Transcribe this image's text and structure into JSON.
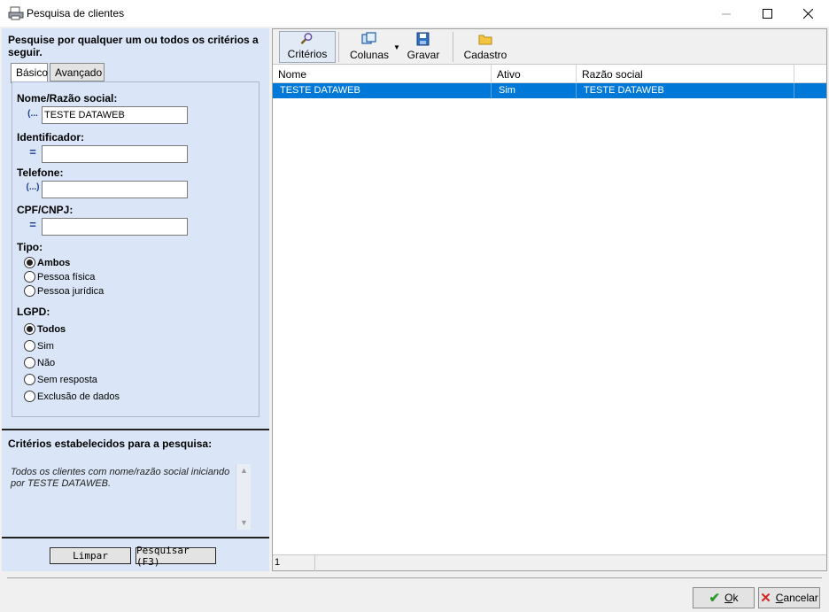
{
  "window": {
    "title": "Pesquisa de clientes",
    "minimize_icon": "minimize-icon",
    "maximize_icon": "maximize-icon",
    "close_icon": "close-icon"
  },
  "left": {
    "prompt": "Pesquise por qualquer um ou todos os critérios a seguir.",
    "tabs": [
      {
        "label": "Básico",
        "active": true
      },
      {
        "label": "Avançado",
        "active": false
      }
    ],
    "fields": [
      {
        "label": "Nome/Razão social:",
        "operator": "(...",
        "value": "TESTE DATAWEB"
      },
      {
        "label": "Identificador:",
        "operator": "=",
        "value": ""
      },
      {
        "label": "Telefone:",
        "operator": "(...)",
        "value": ""
      },
      {
        "label": "CPF/CNPJ:",
        "operator": "=",
        "value": ""
      }
    ],
    "tipo": {
      "label": "Tipo:",
      "options": [
        {
          "label": "Ambos",
          "selected": true
        },
        {
          "label": "Pessoa física",
          "selected": false
        },
        {
          "label": "Pessoa jurídica",
          "selected": false
        }
      ]
    },
    "lgpd": {
      "label": "LGPD:",
      "options": [
        {
          "label": "Todos",
          "selected": true
        },
        {
          "label": "Sim",
          "selected": false
        },
        {
          "label": "Não",
          "selected": false
        },
        {
          "label": "Sem resposta",
          "selected": false
        },
        {
          "label": "Exclusão de dados",
          "selected": false
        }
      ]
    },
    "criteria_title": "Critérios estabelecidos para a pesquisa:",
    "criteria_text": "Todos os clientes com nome/razão social iniciando por TESTE DATAWEB.",
    "buttons": {
      "clear": "Limpar",
      "search": "Pesquisar (F3)"
    }
  },
  "toolbar": {
    "criterios": "Critérios",
    "colunas": "Colunas",
    "gravar": "Gravar",
    "cadastro": "Cadastro"
  },
  "grid": {
    "columns": [
      "Nome",
      "Ativo",
      "Razão social"
    ],
    "rows": [
      [
        "TESTE DATAWEB",
        "Sim",
        "TESTE DATAWEB"
      ]
    ],
    "count": "1"
  },
  "dialog": {
    "ok_prefix": "",
    "ok_accel": "O",
    "ok_rest": "k",
    "cancel_accel": "C",
    "cancel_rest": "ancelar"
  },
  "colors": {
    "panel_bg": "#dae6f7",
    "selection": "#0078d7"
  }
}
